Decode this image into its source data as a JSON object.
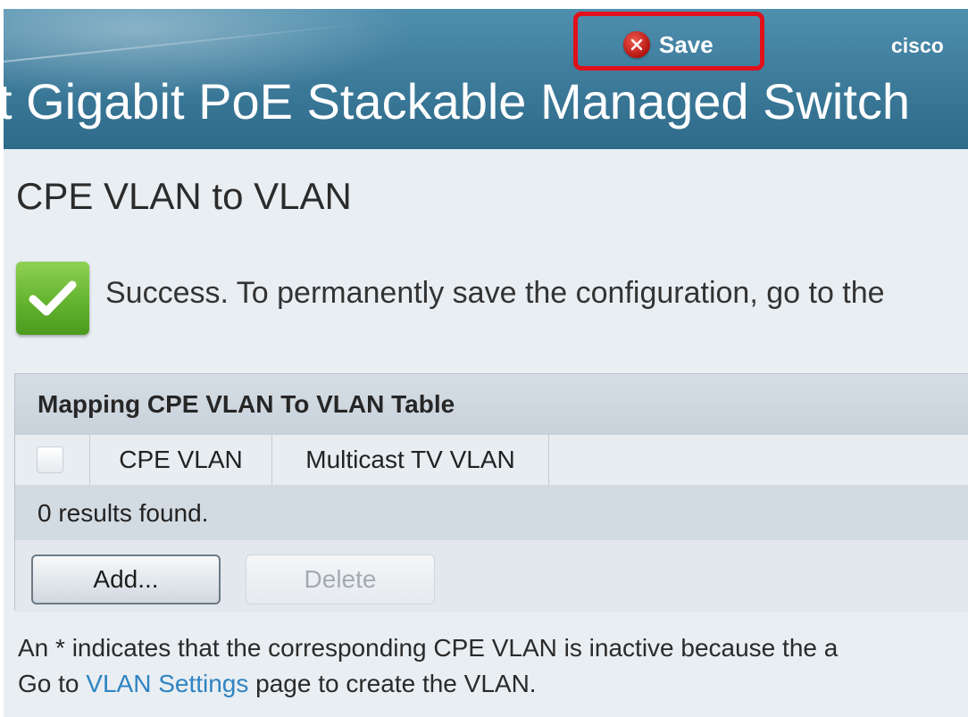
{
  "header": {
    "product_title": "t Gigabit PoE Stackable Managed Switch",
    "save_label": "Save",
    "save_icon": "close-circle-icon",
    "brand": "cisco"
  },
  "page": {
    "title": "CPE VLAN to VLAN"
  },
  "status": {
    "icon": "checkmark-icon",
    "message": "Success. To permanently save the configuration, go to the"
  },
  "table": {
    "title": "Mapping CPE VLAN To VLAN Table",
    "columns": [
      "CPE VLAN",
      "Multicast TV VLAN"
    ],
    "results": "0 results found.",
    "rows": []
  },
  "actions": {
    "add_label": "Add...",
    "delete_label": "Delete"
  },
  "footnote": {
    "line1": "An * indicates that the corresponding CPE VLAN is inactive because the a",
    "line2_prefix": "Go to ",
    "line2_link": "VLAN Settings",
    "line2_suffix": " page to create the VLAN."
  },
  "colors": {
    "header_bg": "#3f7d9d",
    "highlight_border": "#e1101a",
    "success_green": "#64b42f",
    "link": "#2f84c2"
  }
}
